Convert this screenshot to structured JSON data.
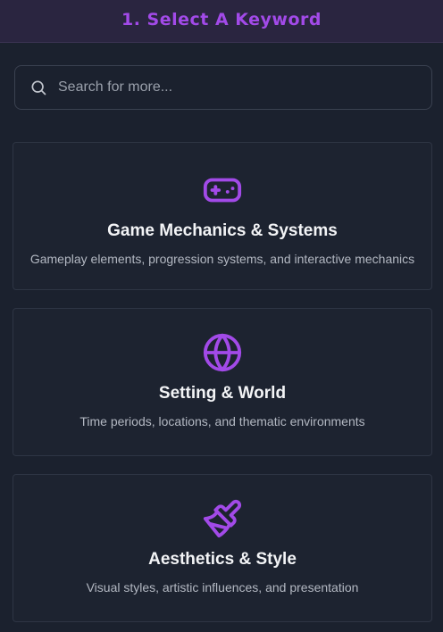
{
  "header": {
    "title": "1. Select A Keyword"
  },
  "search": {
    "placeholder": "Search for more...",
    "value": ""
  },
  "colors": {
    "accent": "#a24ae8",
    "background": "#1b212e",
    "card_border": "#2e3544"
  },
  "categories": [
    {
      "icon": "gamepad-icon",
      "title": "Game Mechanics & Systems",
      "description": "Gameplay elements, progression systems, and interactive mechanics"
    },
    {
      "icon": "globe-icon",
      "title": "Setting & World",
      "description": "Time periods, locations, and thematic environments"
    },
    {
      "icon": "paintbrush-icon",
      "title": "Aesthetics & Style",
      "description": "Visual styles, artistic influences, and presentation"
    }
  ]
}
